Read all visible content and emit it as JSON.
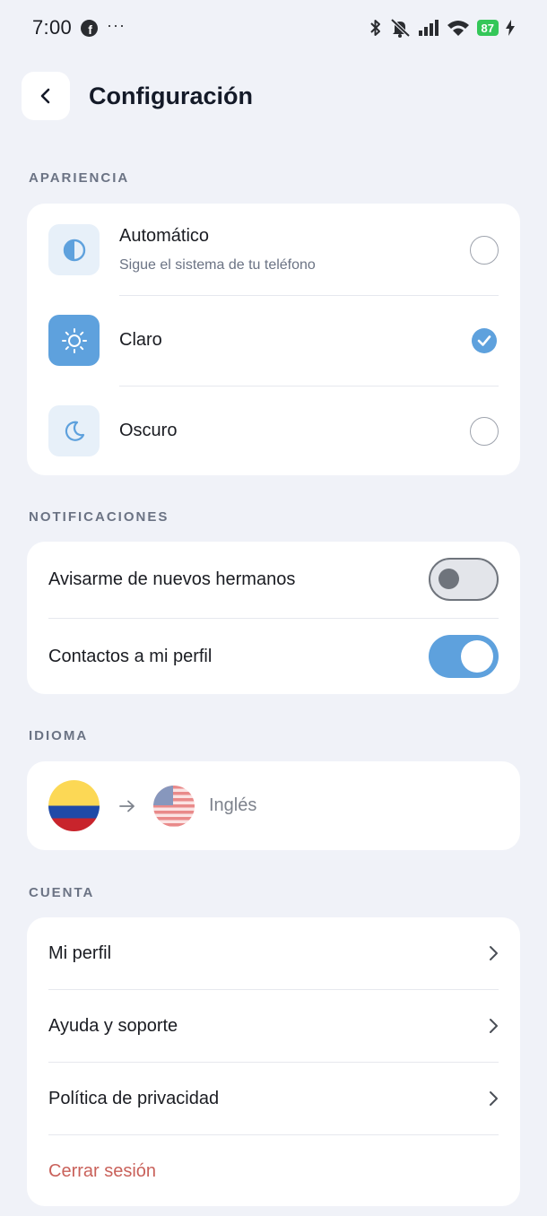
{
  "status_bar": {
    "time": "7:00",
    "app_icon": "facebook-icon",
    "more": "···",
    "battery": "87",
    "icons": [
      "bluetooth-icon",
      "mute-icon",
      "signal-icon",
      "wifi-icon",
      "battery-icon",
      "charging-icon"
    ]
  },
  "header": {
    "title": "Configuración",
    "back_icon": "chevron-left-icon"
  },
  "appearance": {
    "label": "APARIENCIA",
    "options": [
      {
        "title": "Automático",
        "subtitle": "Sigue el sistema de tu teléfono",
        "icon": "half-circle-icon",
        "selected": false
      },
      {
        "title": "Claro",
        "subtitle": "",
        "icon": "sun-icon",
        "selected": true
      },
      {
        "title": "Oscuro",
        "subtitle": "",
        "icon": "moon-icon",
        "selected": false
      }
    ]
  },
  "notifications": {
    "label": "NOTIFICACIONES",
    "items": [
      {
        "label": "Avisarme de nuevos hermanos",
        "enabled": false
      },
      {
        "label": "Contactos a mi perfil",
        "enabled": true
      }
    ]
  },
  "language": {
    "label": "IDIOMA",
    "from_flag": "colombia-flag-icon",
    "to_flag": "usa-flag-icon",
    "target": "Inglés"
  },
  "account": {
    "label": "CUENTA",
    "items": [
      {
        "label": "Mi perfil"
      },
      {
        "label": "Ayuda y soporte"
      },
      {
        "label": "Política de privacidad"
      }
    ],
    "logout": "Cerrar sesión"
  },
  "colors": {
    "accent": "#5ea1dd",
    "background": "#f0f2f8",
    "danger": "#c9615a"
  }
}
